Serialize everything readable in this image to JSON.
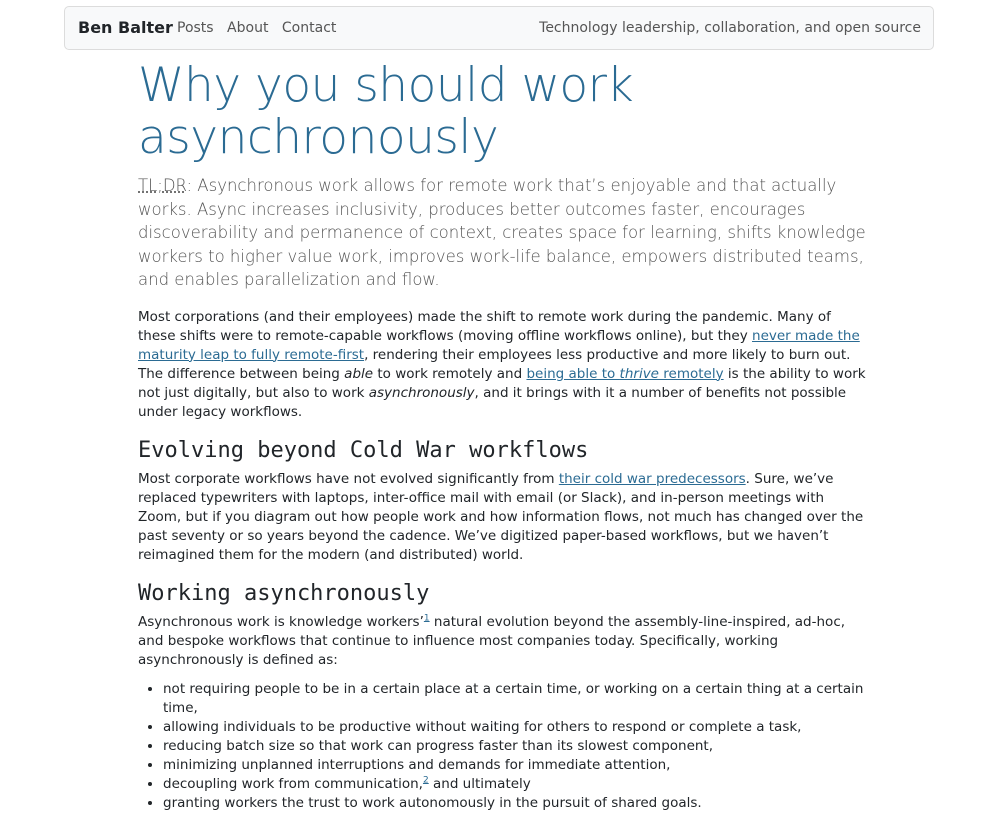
{
  "nav": {
    "brand": "Ben Balter",
    "links": [
      "Posts",
      "About",
      "Contact"
    ],
    "tagline": "Technology leadership, collaboration, and open source"
  },
  "article": {
    "title": "Why you should work asynchronously",
    "lead_abbr": "TL;DR",
    "lead_text": ": Asynchronous work allows for remote work that’s enjoyable and that actually works. Async increases inclusivity, produces better outcomes faster, encourages discoverability and permanence of context, creates space for learning, shifts knowledge workers to higher value work, improves work-life balance, empowers distributed teams, and enables parallelization and flow.",
    "p1": {
      "t1": "Most corporations (and their employees) made the shift to remote work during the pandemic. Many of these shifts were to remote-capable workflows (moving offline workflows online), but they ",
      "link1": "never made the maturity leap to fully remote-first",
      "t2": ", rendering their employees less productive and more likely to burn out. The difference between being ",
      "em1": "able",
      "t3": " to work remotely and ",
      "link2_a": "being able to ",
      "link2_em": "thrive",
      "link2_b": " remotely",
      "t4": " is the ability to work not just digitally, but also to work ",
      "em2": "asynchronously",
      "t5": ", and it brings with it a number of benefits not possible under legacy workflows."
    },
    "h2_1": "Evolving beyond Cold War workflows",
    "p2": {
      "t1": "Most corporate workflows have not evolved significantly from ",
      "link1": "their cold war predecessors",
      "t2": ". Sure, we’ve replaced typewriters with laptops, inter-office mail with email (or Slack), and in-person meetings with Zoom, but if you diagram out how people work and how information flows, not much has changed over the past seventy or so years beyond the cadence. We’ve digitized paper-based workflows, but we haven’t reimagined them for the modern (and distributed) world."
    },
    "h2_2": "Working asynchronously",
    "p3": {
      "t1": "Asynchronous work is knowledge workers’",
      "fn1": "1",
      "t2": " natural evolution beyond the assembly-line-inspired, ad-hoc, and bespoke workflows that continue to influence most companies today. Specifically, working asynchronously is defined as:"
    },
    "list": [
      "not requiring people to be in a certain place at a certain time, or working on a certain thing at a certain time,",
      "allowing individuals to be productive without waiting for others to respond or complete a task,",
      "reducing batch size so that work can progress faster than its slowest component,",
      "minimizing unplanned interruptions and demands for immediate attention,",
      "decoupling work from communication,",
      " and ultimately",
      "granting workers the trust to work autonomously in the pursuit of shared goals."
    ],
    "list_fn": "2"
  }
}
